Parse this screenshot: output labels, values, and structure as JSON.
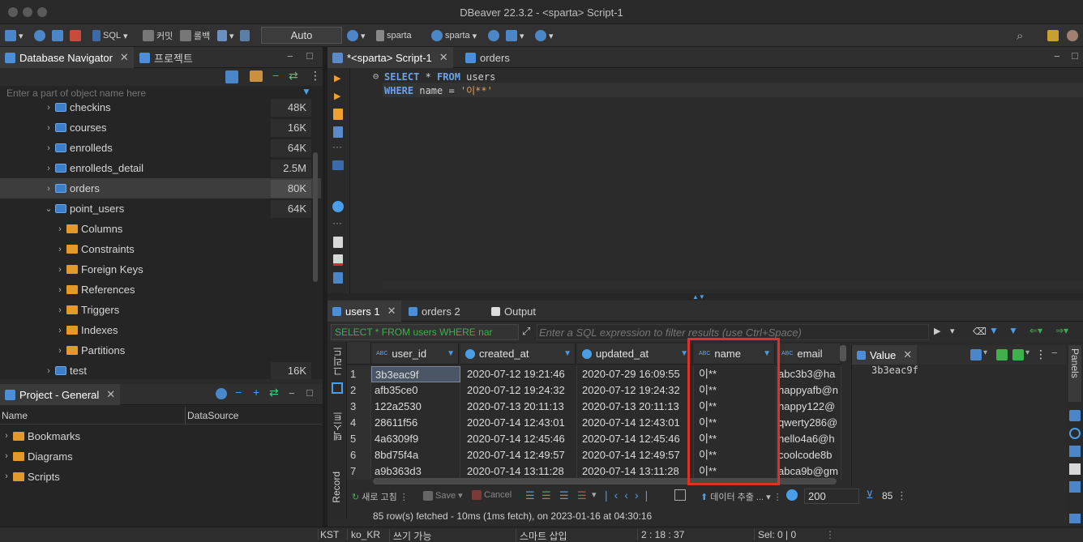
{
  "window": {
    "title": "DBeaver 22.3.2 - <sparta> Script-1"
  },
  "toolbar": {
    "sql_label": "SQL",
    "commit_label": "커밋",
    "rollback_label": "롤백",
    "auto_commit": "Auto",
    "datasource_label": "sparta",
    "schema_label": "sparta"
  },
  "navigator": {
    "tab_label": "Database Navigator",
    "project_tab_label": "프로젝트",
    "filter_placeholder": "Enter a part of object name here",
    "items": [
      {
        "label": "checkins",
        "count": "48K",
        "level": 1,
        "kind": "table",
        "expanded": false
      },
      {
        "label": "courses",
        "count": "16K",
        "level": 1,
        "kind": "table",
        "expanded": false
      },
      {
        "label": "enrolleds",
        "count": "64K",
        "level": 1,
        "kind": "table",
        "expanded": false
      },
      {
        "label": "enrolleds_detail",
        "count": "2.5M",
        "level": 1,
        "kind": "table",
        "expanded": false
      },
      {
        "label": "orders",
        "count": "80K",
        "level": 1,
        "kind": "table",
        "expanded": false,
        "selected": true
      },
      {
        "label": "point_users",
        "count": "64K",
        "level": 1,
        "kind": "table",
        "expanded": true
      },
      {
        "label": "Columns",
        "count": "",
        "level": 2,
        "kind": "folder"
      },
      {
        "label": "Constraints",
        "count": "",
        "level": 2,
        "kind": "folder"
      },
      {
        "label": "Foreign Keys",
        "count": "",
        "level": 2,
        "kind": "folder"
      },
      {
        "label": "References",
        "count": "",
        "level": 2,
        "kind": "folder"
      },
      {
        "label": "Triggers",
        "count": "",
        "level": 2,
        "kind": "folder"
      },
      {
        "label": "Indexes",
        "count": "",
        "level": 2,
        "kind": "folder"
      },
      {
        "label": "Partitions",
        "count": "",
        "level": 2,
        "kind": "folder"
      },
      {
        "label": "test",
        "count": "16K",
        "level": 1,
        "kind": "table",
        "expanded": false
      }
    ]
  },
  "project": {
    "tab_label": "Project - General",
    "col_name": "Name",
    "col_datasource": "DataSource",
    "items": [
      "Bookmarks",
      "Diagrams",
      "Scripts"
    ]
  },
  "editor": {
    "tabs": [
      "*<sparta> Script-1",
      "orders"
    ],
    "line1_kw1": "SELECT",
    "line1_star": " * ",
    "line1_kw2": "FROM",
    "line1_rest": " users",
    "line2_kw": "WHERE",
    "line2_rest": " name = ",
    "line2_str": "'이**'"
  },
  "results": {
    "tabs": [
      "users 1",
      "orders 2",
      "Output"
    ],
    "query_preview": "SELECT * FROM users WHERE nar",
    "filter_placeholder": "Enter a SQL expression to filter results (use Ctrl+Space)",
    "side_label_grid": "그리드",
    "side_label_text": "텍스트",
    "side_label_record": "Record",
    "columns": [
      "user_id",
      "created_at",
      "updated_at",
      "name",
      "email"
    ],
    "rows": [
      [
        "1",
        "3b3eac9f",
        "2020-07-12 19:21:46",
        "2020-07-29 16:09:55",
        "이**",
        "abc3b3@ha"
      ],
      [
        "2",
        "afb35ce0",
        "2020-07-12 19:24:32",
        "2020-07-12 19:24:32",
        "이**",
        "happyafb@n"
      ],
      [
        "3",
        "122a2530",
        "2020-07-13 20:11:13",
        "2020-07-13 20:11:13",
        "이**",
        "happy122@"
      ],
      [
        "4",
        "28611f56",
        "2020-07-14 12:43:01",
        "2020-07-14 12:43:01",
        "이**",
        "qwerty286@"
      ],
      [
        "5",
        "4a6309f9",
        "2020-07-14 12:45:46",
        "2020-07-14 12:45:46",
        "이**",
        "hello4a6@h"
      ],
      [
        "6",
        "8bd75f4a",
        "2020-07-14 12:49:57",
        "2020-07-14 12:49:57",
        "이**",
        "coolcode8b"
      ],
      [
        "7",
        "a9b363d3",
        "2020-07-14 13:11:28",
        "2020-07-14 13:11:28",
        "이**",
        "abca9b@gm"
      ]
    ],
    "value_panel_title": "Value",
    "value_panel_content": "3b3eac9f",
    "panels_label": "Panels",
    "bottom": {
      "refresh": "새로 고침",
      "save": "Save",
      "cancel": "Cancel",
      "export": "데이터 추출 ...",
      "fetch_size": "200",
      "row_count": "85"
    },
    "status_message": "85 row(s) fetched - 10ms (1ms fetch), on 2023-01-16 at 04:30:16"
  },
  "statusbar": {
    "timezone": "KST",
    "locale": "ko_KR",
    "writable": "쓰기 가능",
    "insert_mode": "스마트 삽입",
    "position": "2 : 18 : 37",
    "selection": "Sel: 0 | 0"
  },
  "colors": {
    "highlight_box": "#e0302a",
    "accent": "#4d8fd6",
    "folder": "#e39a2b"
  }
}
